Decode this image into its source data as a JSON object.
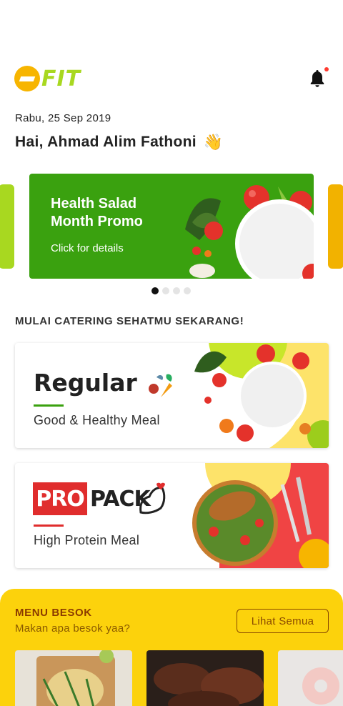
{
  "app": {
    "logo_text": "FIT"
  },
  "header": {
    "date": "Rabu, 25 Sep 2019",
    "greeting": "Hai, Ahmad Alim Fathoni",
    "greeting_emoji": "👋",
    "notification_icon": "bell-icon"
  },
  "promo": {
    "title": "Health Salad Month Promo",
    "subtitle": "Click for details",
    "carousel_pages": 4,
    "active_page": 1,
    "color": "#3aa10f"
  },
  "section": {
    "title": "MULAI CATERING SEHATMU SEKARANG!"
  },
  "packages": [
    {
      "name": "Regular",
      "subtitle": "Good & Healthy Meal",
      "accent": "#3aa10f"
    },
    {
      "name_badge": "PRO",
      "name_rest": "PACK",
      "subtitle": "High Protein Meal",
      "accent": "#e02d2d"
    }
  ],
  "menu": {
    "title": "MENU BESOK",
    "subtitle": "Makan apa besok yaa?",
    "see_all_label": "Lihat Semua",
    "background": "#fcd20c"
  },
  "colors": {
    "brand_green": "#a8d820",
    "brand_yellow": "#f7b500"
  }
}
